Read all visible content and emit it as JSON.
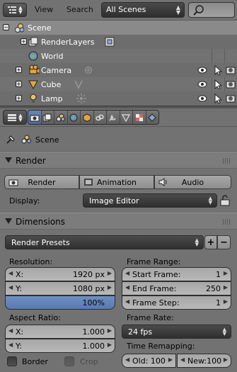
{
  "outliner": {
    "menu": {
      "view": "View",
      "search": "Search"
    },
    "scene_filter": "All Scenes",
    "items": [
      {
        "label": "Scene"
      },
      {
        "label": "RenderLayers"
      },
      {
        "label": "World"
      },
      {
        "label": "Camera"
      },
      {
        "label": "Cube"
      },
      {
        "label": "Lamp"
      }
    ]
  },
  "properties": {
    "context": "Scene",
    "render_panel": {
      "title": "Render",
      "buttons": [
        "Render",
        "Animation",
        "Audio"
      ],
      "display_label": "Display:",
      "display_value": "Image Editor"
    },
    "dimensions_panel": {
      "title": "Dimensions",
      "presets": "Render Presets",
      "resolution_label": "Resolution:",
      "res_x_key": "X:",
      "res_x": "1920 px",
      "res_y_key": "Y:",
      "res_y": "1080 px",
      "res_pct": "100%",
      "aspect_label": "Aspect Ratio:",
      "asp_x_key": "X:",
      "asp_x": "1.000",
      "asp_y_key": "Y:",
      "asp_y": "1.000",
      "frame_range_label": "Frame Range:",
      "start_key": "Start Frame:",
      "start": "1",
      "end_key": "End Frame:",
      "end": "250",
      "step_key": "Frame Step:",
      "step": "1",
      "frame_rate_label": "Frame Rate:",
      "frame_rate": "24 fps",
      "time_remap_label": "Time Remapping:",
      "old": "Old: 100",
      "new": "New:100",
      "border": "Border",
      "crop": "Crop"
    }
  },
  "colors": {
    "accent": "#5a78a8",
    "panel_bg": "#727272",
    "dark_button": "#3a3a3a"
  }
}
